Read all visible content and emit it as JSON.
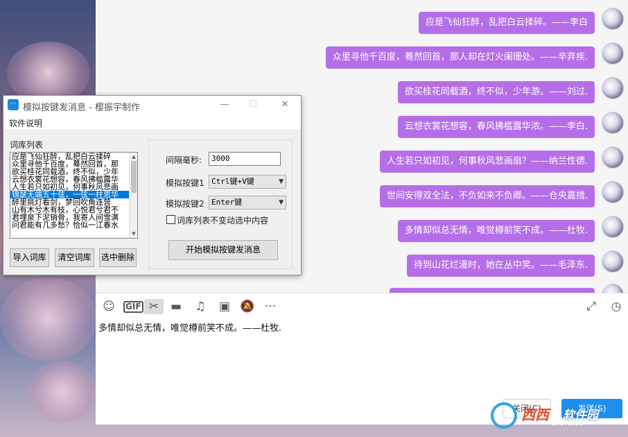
{
  "chat": {
    "messages": [
      {
        "text": "应是飞仙狂醉，乱把白云揉碎。——李白"
      },
      {
        "text": "众里寻他千百度，蓦然回首，那人却在灯火阑珊处。——辛弃疾."
      },
      {
        "text": "欲买桂花同载酒，终不似，少年游。——刘过."
      },
      {
        "text": "云想衣裳花想容，春风拂槛露华浓。——李白."
      },
      {
        "text": "人生若只如初见，何事秋风悲画扇？——纳兰性德."
      },
      {
        "text": "世间安得双全法，不负如来不负卿。——仓央嘉措."
      },
      {
        "text": "多情却似总无情，唯觉樽前笑不成。——杜牧."
      },
      {
        "text": "待到山花烂漫时，她在丛中笑。——毛泽东."
      }
    ],
    "toolbar": {
      "emoji_icon": "smiley-icon",
      "gif_label": "GIF",
      "scissors_icon": "scissors-icon",
      "folder_icon": "folder-icon",
      "music_icon": "music-icon",
      "image_icon": "image-icon",
      "bell_icon": "bell-off-icon",
      "more_icon": "more-icon",
      "expand_icon": "expand-icon",
      "history_icon": "clock-icon"
    },
    "input_text": "多情却似总无情，唯觉樽前笑不成。——杜牧.",
    "close_label": "关闭(C)",
    "send_label": "发送(S)",
    "bubble_color": "#b66ee8"
  },
  "app": {
    "title": "模拟按键发消息 - 樱振宇制作",
    "menu": {
      "help": "软件说明"
    },
    "list_label": "词库列表",
    "list_items": [
      "应是飞仙狂醉，乱把白云揉碎",
      "众里寻他千百度，蓦然回首，那",
      "欲买桂花同载酒，终不似，少年",
      "云想衣裳花想容，春风拂槛露华",
      "人生若只如初见，何事秋风悲画",
      "锦瑟无端五十弦，一弦一柱思华",
      "醉里挑灯看剑，梦回吹角连营",
      "山有木兮木有枝，心悦君兮君不",
      "君埋泉下泥销骨，我寄人间雪满",
      "问君能有几多愁？恰似一江春水"
    ],
    "selected_index": 5,
    "buttons": {
      "import": "导入词库",
      "clear": "清空词库",
      "delete_selected": "选中删除",
      "start": "开始模拟按键发消息"
    },
    "interval_label": "间隔毫秒:",
    "interval_value": "3000",
    "key1_label": "模拟按键1",
    "key1_value": "Ctrl键+V键",
    "key2_label": "模拟按键2",
    "key2_value": "Enter键",
    "checkbox_label": "词库列表不变动选中内容",
    "checkbox_checked": false,
    "window_controls": {
      "minimize": "—",
      "maximize": "☐",
      "close": "✕"
    }
  },
  "watermark": {
    "brand": "西西",
    "subtitle": "软件园",
    "url": "CR173.COM"
  }
}
